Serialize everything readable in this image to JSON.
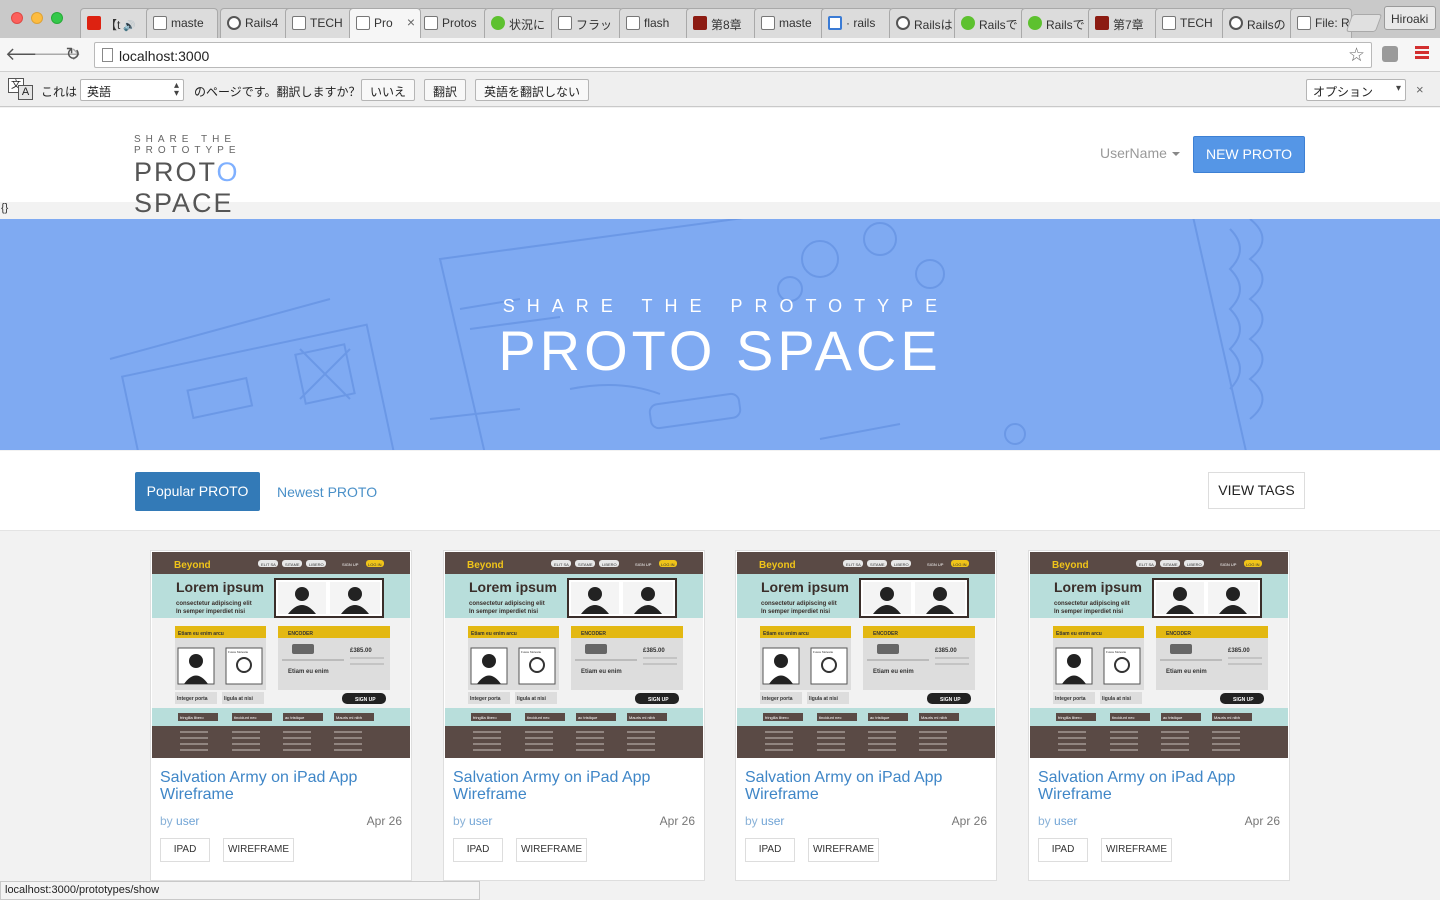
{
  "browser": {
    "tabs": [
      {
        "label": "【t",
        "icon": "youtube-icon",
        "audio": "🔊",
        "favicon": "fav-red"
      },
      {
        "label": "maste",
        "icon": "document-icon",
        "favicon": "fav-doc"
      },
      {
        "label": "Rails4",
        "icon": "rails-icon",
        "favicon": "fav-circle"
      },
      {
        "label": "TECH",
        "icon": "document-icon",
        "favicon": "fav-doc"
      },
      {
        "label": "Pro",
        "icon": "document-icon",
        "favicon": "fav-doc",
        "active": true
      },
      {
        "label": "Protos",
        "icon": "document-icon",
        "favicon": "fav-doc"
      },
      {
        "label": "状況に",
        "icon": "qiita-icon",
        "favicon": "fav-green"
      },
      {
        "label": "フラッ",
        "icon": "document-icon",
        "favicon": "fav-doc"
      },
      {
        "label": "flash",
        "icon": "document-icon",
        "favicon": "fav-doc"
      },
      {
        "label": "第8章",
        "icon": "photo-icon",
        "favicon": "fav-photo"
      },
      {
        "label": "maste",
        "icon": "document-icon",
        "favicon": "fav-doc"
      },
      {
        "label": "· rails",
        "icon": "grid-icon",
        "favicon": "fav-grid"
      },
      {
        "label": "Railsは",
        "icon": "rails-icon",
        "favicon": "fav-circle"
      },
      {
        "label": "Railsで",
        "icon": "qiita-icon",
        "favicon": "fav-green"
      },
      {
        "label": "Railsで",
        "icon": "qiita-icon",
        "favicon": "fav-green"
      },
      {
        "label": "第7章",
        "icon": "photo-icon",
        "favicon": "fav-photo"
      },
      {
        "label": "TECH",
        "icon": "document-icon",
        "favicon": "fav-doc"
      },
      {
        "label": "Railsの",
        "icon": "rails-icon",
        "favicon": "fav-circle"
      },
      {
        "label": "File: R",
        "icon": "document-icon",
        "favicon": "fav-doc"
      }
    ],
    "tab_close": "×",
    "profile": "Hiroaki",
    "url": "localhost:3000",
    "back_glyph": "🡐",
    "forward_glyph": "🡒",
    "reload_glyph": "↻",
    "star_glyph": "☆"
  },
  "translate_bar": {
    "icon_a": "文",
    "icon_b": "A",
    "prefix": "これは",
    "language": "英語",
    "suffix": "のページです。翻訳しますか？",
    "no_label": "いいえ",
    "translate_label": "翻訳",
    "never_label": "英語を翻訳しない",
    "options_label": "オプション",
    "close_glyph": "×"
  },
  "header": {
    "logo_tag": "SHARE THE PROTOTYPE",
    "logo_name_a": "PROT",
    "logo_name_o": "O",
    "logo_name_b": " SPACE",
    "username": "UserName",
    "new_proto_label": "NEW PROTO"
  },
  "debug_text": "{}",
  "hero": {
    "tag": "SHARE THE PROTOTYPE",
    "title": "PROTO SPACE"
  },
  "filters": {
    "popular_label": "Popular PROTO",
    "newest_label": "Newest PROTO",
    "view_tags_label": "VIEW TAGS"
  },
  "thumbnail": {
    "brand": "Beyond",
    "nav": [
      "ELIT SA",
      "SITAME",
      "LIBERO",
      "SIGN UP",
      "LOG IN"
    ],
    "headline": "Lorem ipsum",
    "sub1": "consectetur adipiscing elit",
    "sub2": "In semper imperdiet nisi",
    "box1": "Etiam eu enim arcu",
    "box2": "ENCODER",
    "price": "£385.00",
    "name1": "Fusce Molestie",
    "name2": "Etiam eu enim",
    "row1": "Integer porta",
    "row2": "ligula at nisi",
    "signup": "SIGN UP",
    "band": [
      "fringilla libero",
      "tincidunt nec",
      "ac tristique",
      "Mauris mi nibh"
    ]
  },
  "cards": [
    {
      "title": "Salvation Army on iPad App Wireframe",
      "by": "by",
      "user": "user",
      "date": "Apr 26",
      "tags": [
        "IPAD",
        "WIREFRAME"
      ]
    },
    {
      "title": "Salvation Army on iPad App Wireframe",
      "by": "by",
      "user": "user",
      "date": "Apr 26",
      "tags": [
        "IPAD",
        "WIREFRAME"
      ]
    },
    {
      "title": "Salvation Army on iPad App Wireframe",
      "by": "by",
      "user": "user",
      "date": "Apr 26",
      "tags": [
        "IPAD",
        "WIREFRAME"
      ]
    },
    {
      "title": "Salvation Army on iPad App Wireframe",
      "by": "by",
      "user": "user",
      "date": "Apr 26",
      "tags": [
        "IPAD",
        "WIREFRAME"
      ]
    }
  ],
  "status_bar": "localhost:3000/prototypes/show",
  "colors": {
    "accent": "#5596e6",
    "primary_btn": "#337ab7",
    "hero_bg": "#7faaf2",
    "link": "#3f86c7"
  }
}
